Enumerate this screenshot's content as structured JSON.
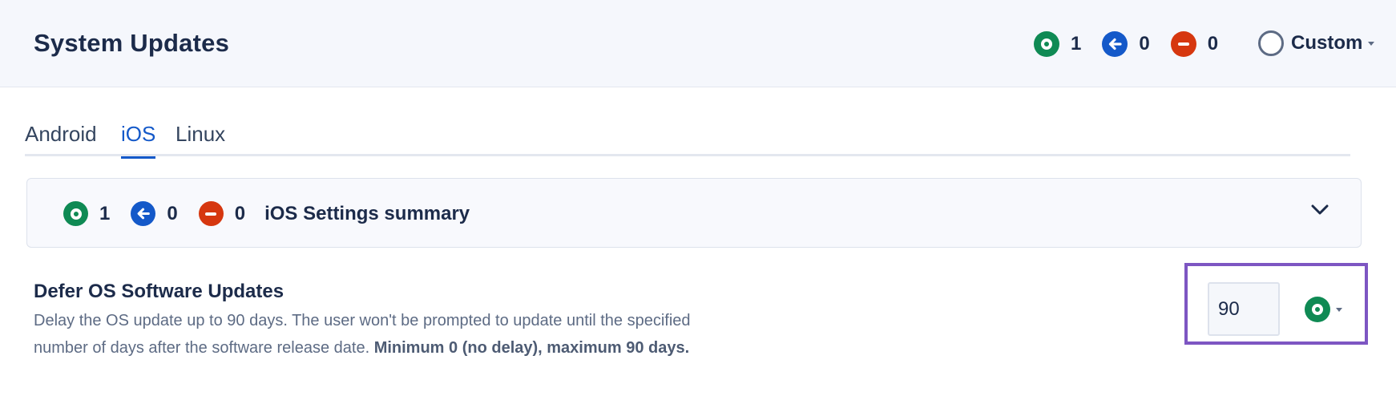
{
  "header": {
    "title": "System Updates",
    "stats": {
      "compliant": "1",
      "inherited": "0",
      "blocked": "0"
    },
    "profile": {
      "label": "Custom"
    }
  },
  "tabs": [
    {
      "label": "Android"
    },
    {
      "label": "iOS"
    },
    {
      "label": "Linux"
    }
  ],
  "active_tab": "iOS",
  "summary": {
    "stats": {
      "compliant": "1",
      "inherited": "0",
      "blocked": "0"
    },
    "title": "iOS Settings summary"
  },
  "setting": {
    "title": "Defer OS Software Updates",
    "description": "Delay the OS update up to 90 days. The user won't be prompted to update until the specified number of days after the software release date.",
    "constraint": "Minimum 0 (no delay), maximum 90 days.",
    "value": "90",
    "status_icon": "green-circle-icon"
  },
  "colors": {
    "green": "#0f8a54",
    "blue": "#1459c9",
    "red": "#d6370f",
    "highlight": "#7d56c2"
  }
}
